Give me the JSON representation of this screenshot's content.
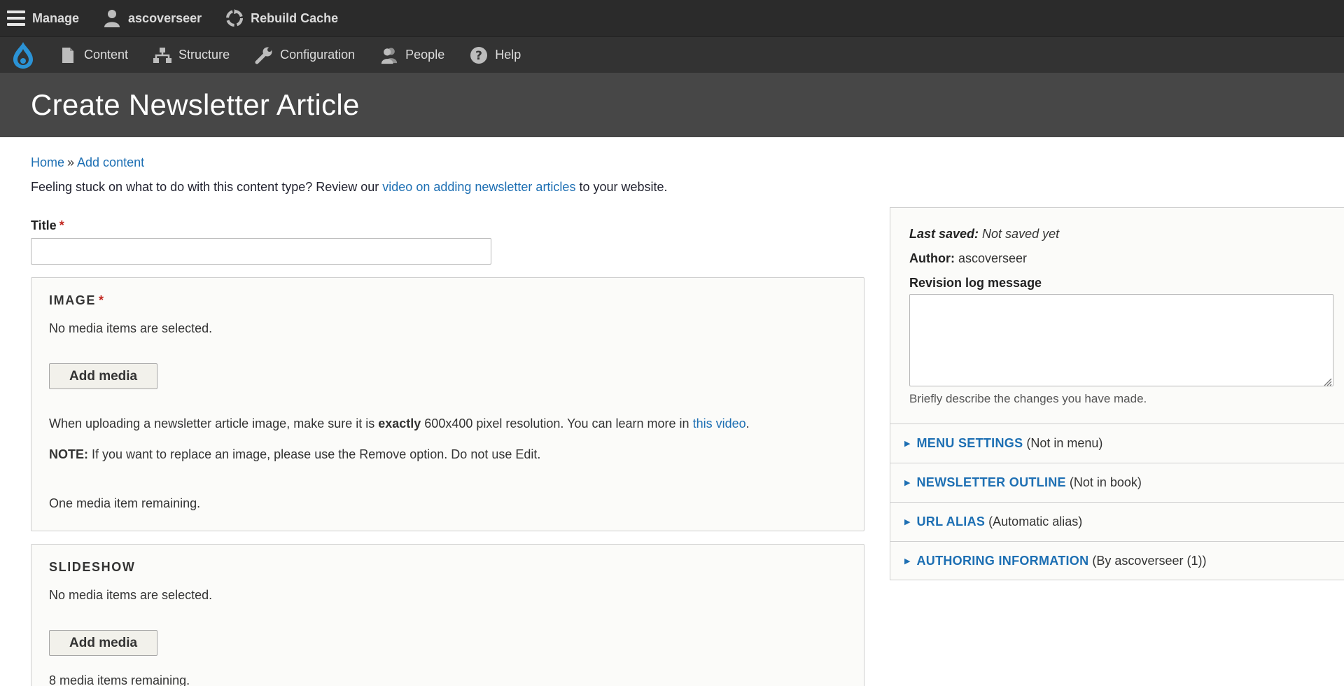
{
  "toolbar": {
    "manage": "Manage",
    "user": "ascoverseer",
    "rebuild": "Rebuild Cache"
  },
  "tray": {
    "items": [
      "Content",
      "Structure",
      "Configuration",
      "People",
      "Help"
    ]
  },
  "page": {
    "title": "Create Newsletter Article"
  },
  "breadcrumb": {
    "home": "Home",
    "separator": "»",
    "add_content": "Add content"
  },
  "help": {
    "before": "Feeling stuck on what to do with this content type? Review our ",
    "link": "video on adding newsletter articles",
    "after": " to your website."
  },
  "title_field": {
    "label": "Title",
    "required_mark": "*",
    "value": ""
  },
  "image_field": {
    "legend": "IMAGE",
    "required_mark": "*",
    "empty": "No media items are selected.",
    "button": "Add media",
    "desc_1": "When uploading a newsletter article image, make sure it is ",
    "desc_bold": "exactly",
    "desc_2": " 600x400 pixel resolution. You can learn more in ",
    "desc_link": "this video",
    "desc_end": ".",
    "note_label": "NOTE:",
    "note_text": " If you want to replace an image, please use the Remove option. Do not use Edit.",
    "remaining": "One media item remaining."
  },
  "slideshow_field": {
    "legend": "SLIDESHOW",
    "empty": "No media items are selected.",
    "button": "Add media",
    "remaining": "8 media items remaining."
  },
  "sidebar": {
    "last_saved_label": "Last saved:",
    "last_saved_value": " Not saved yet",
    "author_label": "Author:",
    "author_value": " ascoverseer",
    "revision_label": "Revision log message",
    "revision_desc": "Briefly describe the changes you have made.",
    "sections": [
      {
        "title": "MENU SETTINGS",
        "summary": "(Not in menu)"
      },
      {
        "title": "NEWSLETTER OUTLINE",
        "summary": "(Not in book)"
      },
      {
        "title": "URL ALIAS",
        "summary": "(Automatic alias)"
      },
      {
        "title": "AUTHORING INFORMATION",
        "summary": "(By ascoverseer (1))"
      }
    ]
  },
  "colors": {
    "link": "#1d6fb3",
    "required": "#c2261f",
    "toolbar": "#2b2b2b",
    "header": "#474747"
  }
}
